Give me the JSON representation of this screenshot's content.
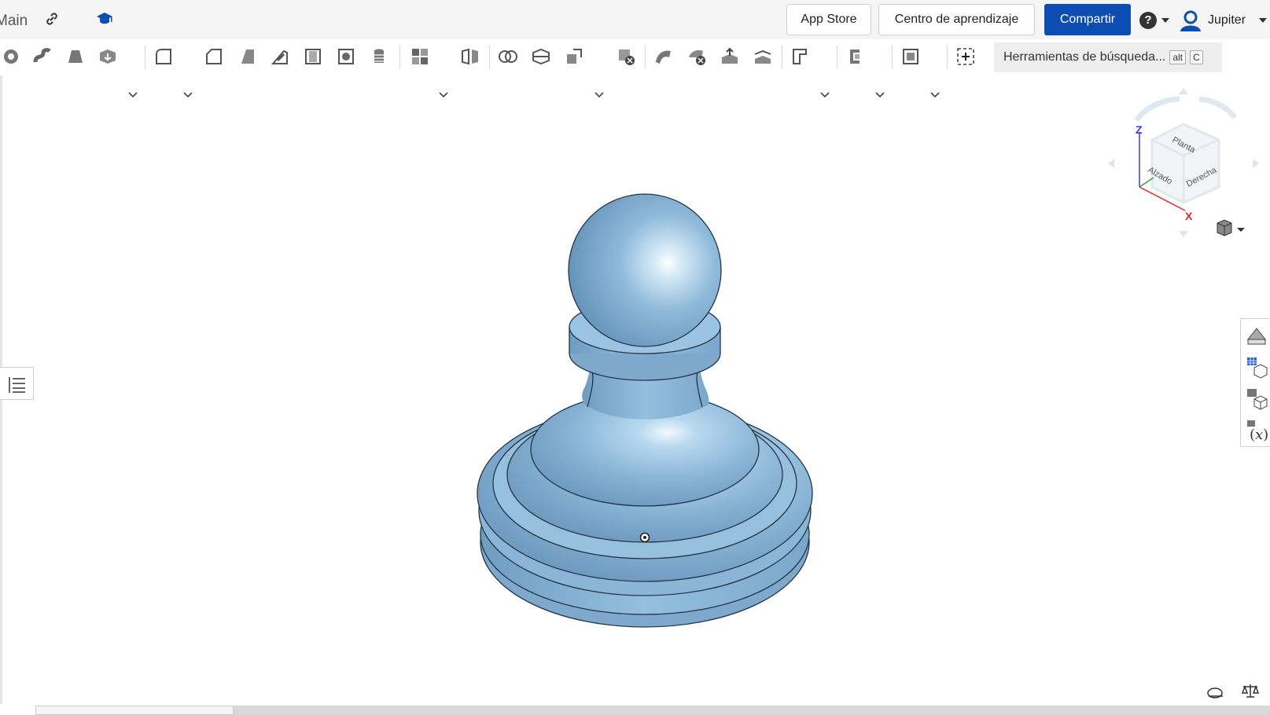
{
  "header": {
    "doc_name": "Main",
    "app_store_label": "App Store",
    "learning_center_label": "Centro de aprendizaje",
    "share_label": "Compartir",
    "help_glyph": "?",
    "user_name": "Jupiter"
  },
  "toolbar": {
    "search_label": "Herramientas de búsqueda...",
    "shortcut_mod": "alt",
    "shortcut_key": "C"
  },
  "view_cube": {
    "top_face": "Planta",
    "front_face": "Alzado",
    "right_face": "Derecha",
    "axis_z": "Z",
    "axis_x": "X"
  },
  "colors": {
    "primary": "#0b4db3",
    "model": "#8fb9d9",
    "axis_z": "#3a3ad6",
    "axis_x": "#e02b2b"
  }
}
